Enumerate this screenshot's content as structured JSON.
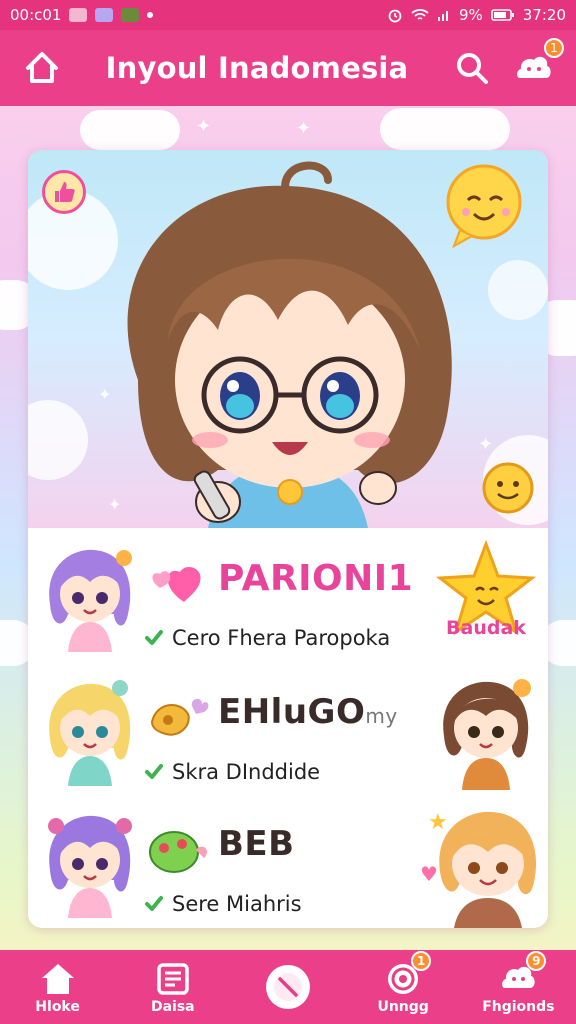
{
  "status_bar": {
    "time_left": "00:c01",
    "battery": "9%",
    "time_right": "37:20"
  },
  "header": {
    "title": "Inyoul Inadomesia",
    "notification_count": "1"
  },
  "rows": [
    {
      "title": "PARIONI1",
      "subtitle": "Cero Fhera Paropoka",
      "side_label": "Baudak"
    },
    {
      "title": "EHluGO",
      "title_small": "my",
      "subtitle": "Skra DInddide"
    },
    {
      "title": "BEB",
      "subtitle": "Sere Miahris"
    }
  ],
  "bottom_nav": [
    {
      "label": "Hloke",
      "icon": "home-icon"
    },
    {
      "label": "Daisa",
      "icon": "news-icon"
    },
    {
      "label": "",
      "icon": "clock-icon"
    },
    {
      "label": "Unngg",
      "icon": "target-icon",
      "badge": "1"
    },
    {
      "label": "Fhgionds",
      "icon": "chat-bubble-icon",
      "badge": "9"
    }
  ],
  "colors": {
    "brand_pink": "#ec3f8a",
    "title_pink": "#e8449b",
    "check_green": "#3fb34f",
    "badge_orange": "#ff8f2e"
  }
}
